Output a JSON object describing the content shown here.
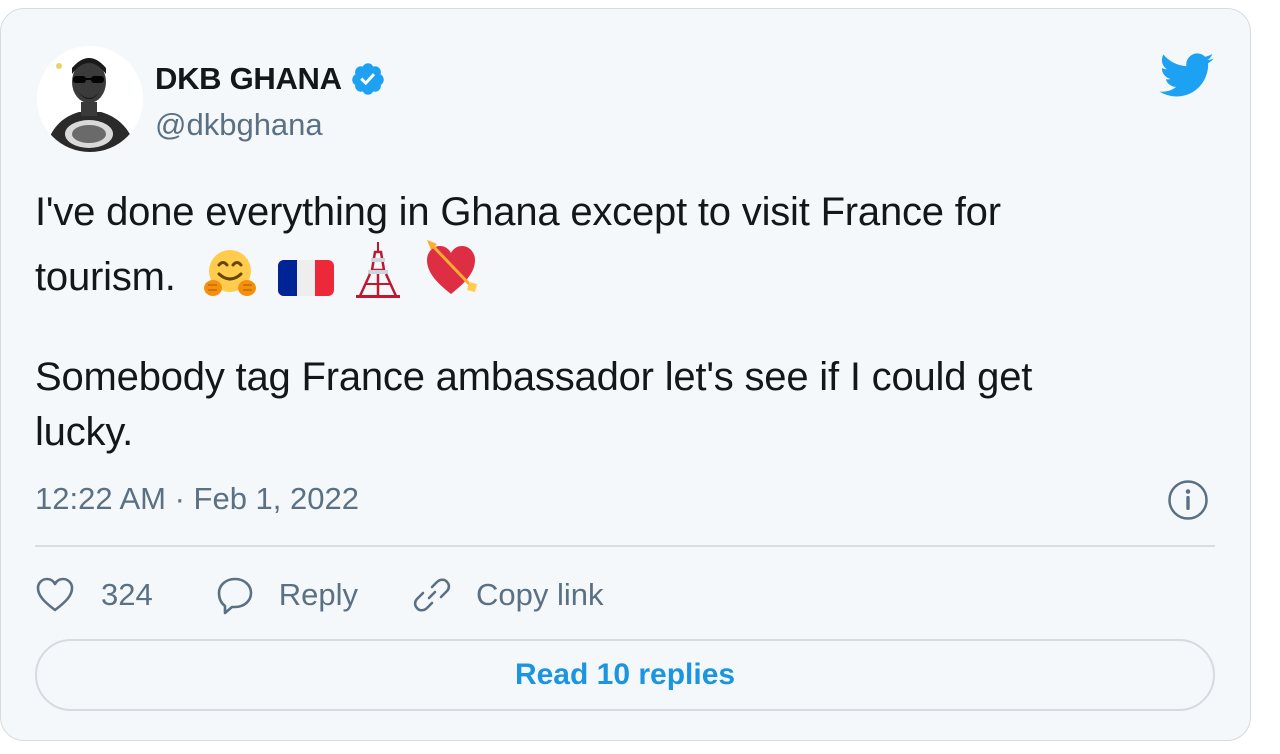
{
  "author": {
    "name": "DKB GHANA",
    "handle": "@dkbghana",
    "verified": true
  },
  "tweet": {
    "line1": "I've done everything in Ghana except to visit France for",
    "line2": "tourism.",
    "line2_emojis": [
      "hugging-face",
      "france-flag",
      "tokyo-tower",
      "heart-with-arrow"
    ],
    "line3": "Somebody tag France ambassador let's see if I could get",
    "line4": "lucky."
  },
  "meta": {
    "timestamp": "12:22 AM · Feb 1, 2022"
  },
  "actions": {
    "likes": "324",
    "reply_label": "Reply",
    "copy_label": "Copy link"
  },
  "replies_button": "Read 10 replies",
  "icons": [
    "twitter-bird-icon",
    "verified-badge-icon",
    "info-icon",
    "heart-icon",
    "reply-icon",
    "link-icon"
  ],
  "colors": {
    "accent": "#1b95e0",
    "twitter_blue": "#1da1f2",
    "muted_text": "#5b7083",
    "card_background": "#f5f8fa"
  }
}
